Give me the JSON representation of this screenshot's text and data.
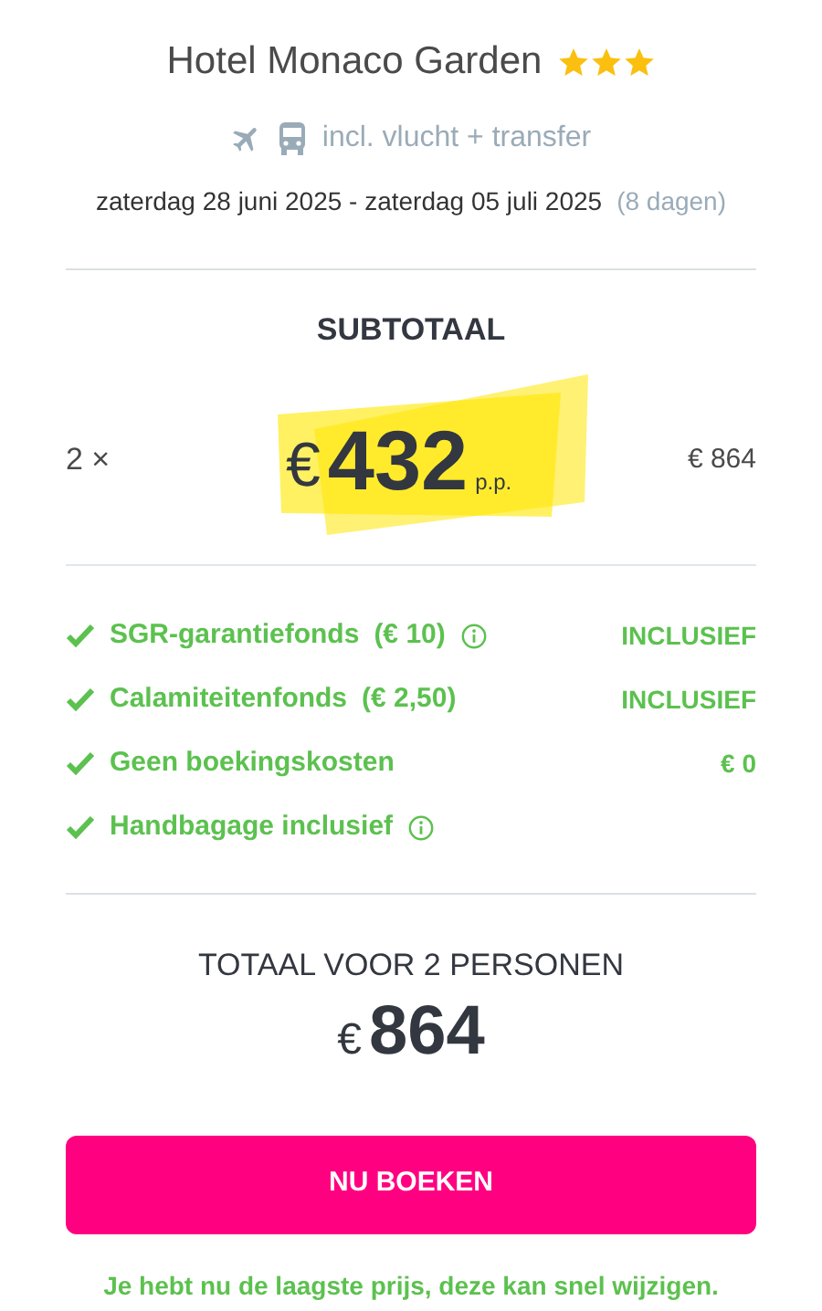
{
  "hotel": {
    "name": "Hotel Monaco Garden",
    "stars": 3
  },
  "includes": "incl. vlucht + transfer",
  "dates": {
    "range": "zaterdag 28 juni 2025 - zaterdag 05 juli 2025",
    "duration": "(8 dagen)"
  },
  "subtotal": {
    "title": "SUBTOTAAL",
    "quantity": "2 ×",
    "currency": "€",
    "price": "432",
    "per_person": "p.p.",
    "total": "€ 864"
  },
  "items": [
    {
      "label": "SGR-garantiefonds",
      "note": "(€ 10)",
      "info": true,
      "value": "INCLUSIEF"
    },
    {
      "label": "Calamiteitenfonds",
      "note": "(€ 2,50)",
      "info": false,
      "value": "INCLUSIEF"
    },
    {
      "label": "Geen boekingskosten",
      "info": false,
      "value": "€ 0"
    },
    {
      "label": "Handbagage inclusief",
      "info": true
    }
  ],
  "total": {
    "title": "TOTAAL VOOR 2 PERSONEN",
    "currency": "€",
    "amount": "864"
  },
  "button": "NU BOEKEN",
  "footer": "Je hebt nu de laagste prijs, deze kan snel wijzigen."
}
